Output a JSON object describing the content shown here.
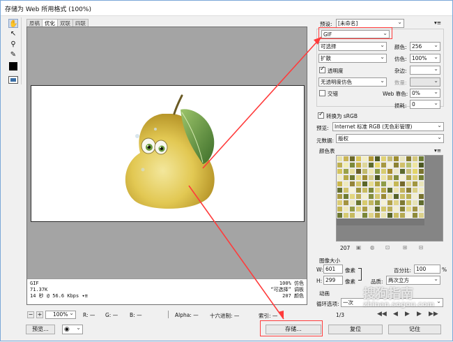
{
  "window": {
    "title": "存储为 Web 所用格式 (100%)"
  },
  "tools": [
    "hand-icon",
    "slice-select-icon",
    "zoom-icon",
    "eyedropper-icon"
  ],
  "tabs": [
    {
      "label": "原稿",
      "active": false
    },
    {
      "label": "优化",
      "active": true
    },
    {
      "label": "双联",
      "active": false
    },
    {
      "label": "四联",
      "active": false
    }
  ],
  "info": {
    "format": "GIF",
    "size": "71.37K",
    "time": "14 秒 @ 56.6 Kbps",
    "quality": "100% 仿色",
    "palette": "“可选择” 调板",
    "colors": "207 颜色"
  },
  "bottom": {
    "zoom": "100%",
    "r_label": "R:",
    "r_value": "—",
    "g_label": "G:",
    "g_value": "—",
    "b_label": "B:",
    "b_value": "—",
    "alpha_label": "Alpha:",
    "alpha_value": "—",
    "hex_label": "十六进制:",
    "hex_value": "—",
    "index_label": "索引:",
    "index_value": "—",
    "preview_btn": "预览...",
    "save_btn": "存储...",
    "reset_btn": "复位",
    "remember_btn": "记住"
  },
  "settings": {
    "preset_label": "预设:",
    "preset_value": "[未命名]",
    "format": "GIF",
    "reduction": "可选择",
    "dither_algo": "扩散",
    "transparency_label": "透明度",
    "transparency_checked": true,
    "matte_dither": "无透明度仿色",
    "interlaced_label": "交错",
    "interlaced_checked": false,
    "colors_label": "颜色:",
    "colors_value": "256",
    "dither_label": "仿色:",
    "dither_value": "100%",
    "matte_label": "杂边:",
    "amount_label": "数量:",
    "websnap_label": "Web 靠色:",
    "websnap_value": "0%",
    "lossy_label": "损耗:",
    "lossy_value": "0",
    "srgb_label": "转换为 sRGB",
    "srgb_checked": true,
    "preview_label": "预览:",
    "preview_value": "Internet 标准 RGB (无色彩管理)",
    "metadata_label": "元数据:",
    "metadata_value": "版权"
  },
  "color_table": {
    "title": "颜色表",
    "count": "207"
  },
  "image_size": {
    "title": "图像大小",
    "w_label": "W:",
    "w_value": "601",
    "w_unit": "像素",
    "h_label": "H:",
    "h_value": "299",
    "h_unit": "像素",
    "percent_label": "百分比:",
    "percent_value": "100",
    "percent_unit": "%",
    "quality_label": "品质:",
    "quality_value": "两次立方"
  },
  "animation": {
    "title": "动画",
    "loop_label": "循环选项:",
    "loop_value": "一次",
    "frame": "1/3"
  },
  "watermark": {
    "text": "搜狗指南",
    "url": "zhinan.sogou.com"
  },
  "colors": {
    "highlight": "#ff3b3b",
    "canvas": "#a4a4a4",
    "swatches": [
      "#e8e2a8",
      "#c9b454",
      "#6d6a2a",
      "#d9c65c",
      "#f4efc4",
      "#b49a36",
      "#4f5a24",
      "#e0d276",
      "#c7bd74",
      "#9c8c2e",
      "#eae6c0",
      "#857a2c",
      "#d5c87c",
      "#6e7c34",
      "#bdb050",
      "#f2eeb2",
      "#7d8a3a",
      "#c4ac42",
      "#dfd79a",
      "#5f6c2c",
      "#e9d86a",
      "#a69842",
      "#f6f3d8",
      "#8c8234",
      "#d0c06a",
      "#b8c06c",
      "#efe6a0",
      "#4c5822",
      "#d4c45c",
      "#9aa248",
      "#e6df9e",
      "#6a622a",
      "#c2ba6c",
      "#f0e8b4",
      "#8a9a44",
      "#d8cc70",
      "#a88e30",
      "#ece8c8",
      "#5c6a2e",
      "#c9c07a",
      "#e2d46a",
      "#7a7430",
      "#f3efc6",
      "#b6aa46",
      "#6c7830",
      "#e4da84",
      "#9e8c34",
      "#d6ce8c",
      "#4e5a26",
      "#ebe2a4",
      "#c0b058",
      "#828c3c",
      "#f5f1d4",
      "#a8a04a",
      "#dccf78",
      "#727e34",
      "#cab64c",
      "#eee9bc",
      "#94843a",
      "#d2c46a",
      "#5a6628",
      "#e6dc90",
      "#b0a444",
      "#8e9c48",
      "#f1edca",
      "#c6b856",
      "#74682c",
      "#ded490",
      "#a29640",
      "#e8e4b8",
      "#647030",
      "#d0c268",
      "#f7f4dc",
      "#9c943e",
      "#c8bc62",
      "#7c8838",
      "#e4d88a",
      "#b4a648",
      "#5e6c2c",
      "#ece4ae",
      "#c2b45c",
      "#8a7e34",
      "#dad086",
      "#f0ecc0",
      "#a89a42",
      "#6e7a32",
      "#e2d680",
      "#beb05a",
      "#f4f0cc",
      "#848e3e",
      "#d4c872",
      "#9a8a36",
      "#e8e0a6",
      "#56622a",
      "#cabe66",
      "#b8ae50",
      "#f2eed0",
      "#767230",
      "#dccc74",
      "#a49440",
      "#ebe6c2",
      "#6a7630",
      "#d8ca6e",
      "#c0b660",
      "#8c9440",
      "#f6f2d6",
      "#b2a24a",
      "#e0d488",
      "#7e7a34",
      "#cec464",
      "#e6e2b6",
      "#606c2e",
      "#c4b452",
      "#f0eabc",
      "#929a46",
      "#dcd07c",
      "#aa9c44",
      "#ece8c4",
      "#5c682c",
      "#d2c66c",
      "#bcb05a",
      "#f4f0d0",
      "#868236",
      "#e4da8c",
      "#a09242",
      "#e8e4bc",
      "#6c7832",
      "#d6ca70",
      "#c6ba5e",
      "#f2eed2",
      "#7a8638",
      "#ded288",
      "#ae9e46",
      "#eae4b0",
      "#586428",
      "#ccbe62",
      "#b6aa52",
      "#f6f2da",
      "#8e8a3a",
      "#dad08a"
    ]
  }
}
